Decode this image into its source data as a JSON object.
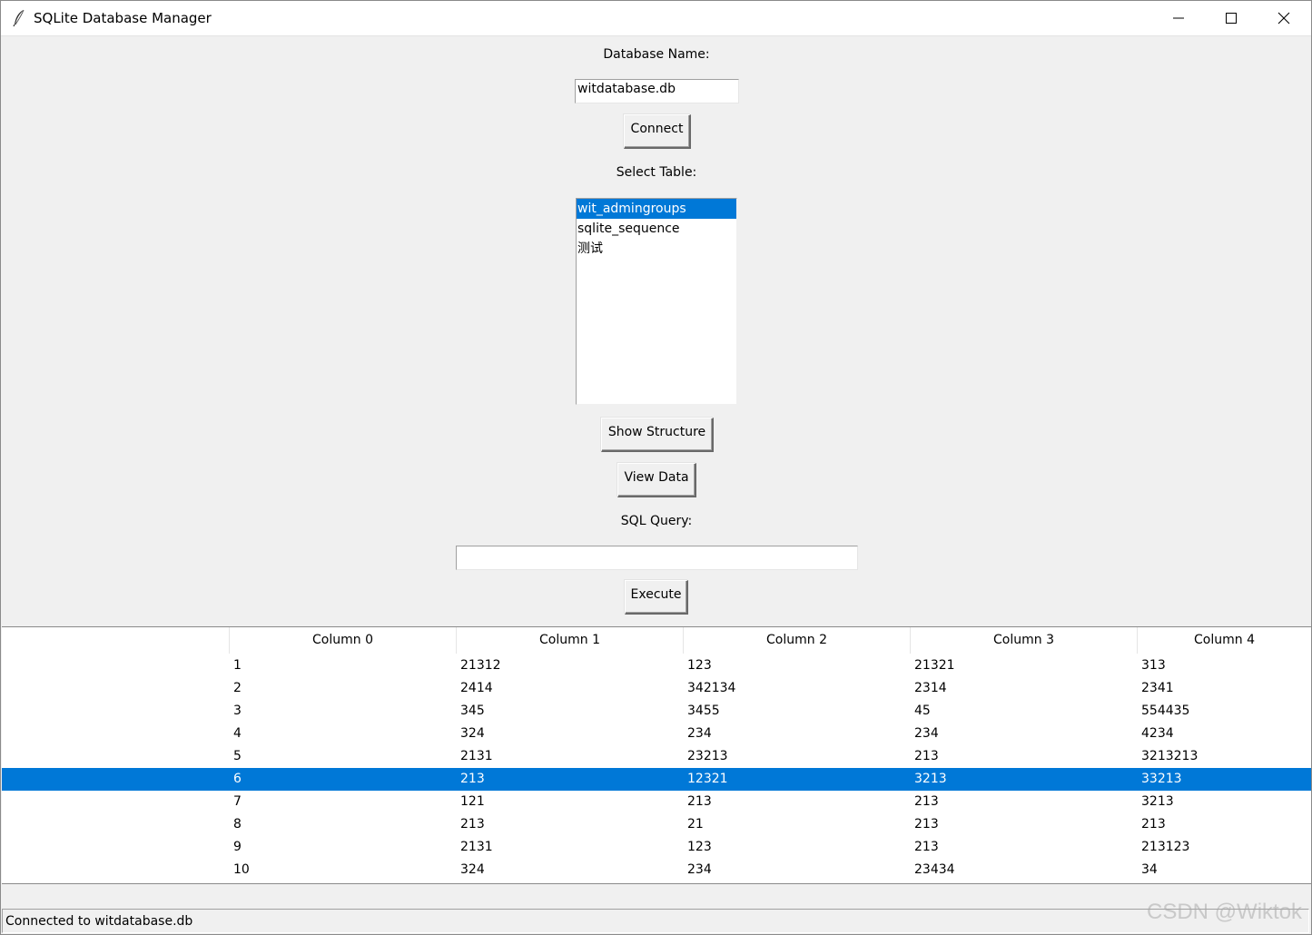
{
  "window": {
    "title": "SQLite Database Manager",
    "icon": "feather-icon",
    "controls": [
      "minimize-icon",
      "maximize-icon",
      "close-icon"
    ]
  },
  "form": {
    "db_name_label": "Database Name:",
    "db_name_value": "witdatabase.db",
    "connect_label": "Connect",
    "select_table_label": "Select Table:",
    "tables": [
      {
        "name": "wit_admingroups",
        "selected": true
      },
      {
        "name": "sqlite_sequence",
        "selected": false
      },
      {
        "name": "测试",
        "selected": false
      }
    ],
    "show_structure_label": "Show Structure",
    "view_data_label": "View Data",
    "sql_query_label": "SQL Query:",
    "sql_query_value": "",
    "execute_label": "Execute"
  },
  "results": {
    "columns": [
      "",
      "Column 0",
      "Column 1",
      "Column 2",
      "Column 3",
      "Column 4"
    ],
    "rows": [
      [
        "",
        "1",
        "21312",
        "123",
        "21321",
        "313"
      ],
      [
        "",
        "2",
        "2414",
        "342134",
        "2314",
        "2341"
      ],
      [
        "",
        "3",
        "345",
        "3455",
        "45",
        "554435"
      ],
      [
        "",
        "4",
        "324",
        "234",
        "234",
        "4234"
      ],
      [
        "",
        "5",
        "2131",
        "23213",
        "213",
        "3213213"
      ],
      [
        "",
        "6",
        "213",
        "12321",
        "3213",
        "33213"
      ],
      [
        "",
        "7",
        "121",
        "213",
        "213",
        "3213"
      ],
      [
        "",
        "8",
        "213",
        "21",
        "213",
        "213"
      ],
      [
        "",
        "9",
        "2131",
        "123",
        "213",
        "213123"
      ],
      [
        "",
        "10",
        "324",
        "234",
        "23434",
        "34"
      ]
    ],
    "selected_row": 5
  },
  "status": {
    "text": "Connected to witdatabase.db"
  },
  "watermark": "CSDN @Wiktok",
  "colors": {
    "selection": "#0078d7",
    "background": "#f0f0f0"
  }
}
